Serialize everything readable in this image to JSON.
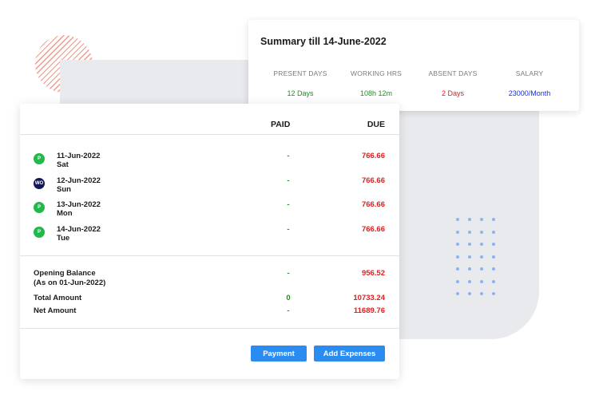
{
  "summary": {
    "title": "Summary till 14-June-2022",
    "stats": [
      {
        "label": "PRESENT DAYS",
        "value": "12 Days",
        "color": "#1f8d1f"
      },
      {
        "label": "WORKING HRS",
        "value": "108h 12m",
        "color": "#1f8d1f"
      },
      {
        "label": "ABSENT DAYS",
        "value": "2 Days",
        "color": "#e01d1d"
      },
      {
        "label": "SALARY",
        "value": "23000/Month",
        "color": "#1a2ee0"
      }
    ]
  },
  "table": {
    "col_paid": "PAID",
    "col_due": "DUE",
    "rows": [
      {
        "badge": "P",
        "date": "11-Jun-2022",
        "day": "Sat",
        "paid": "-",
        "due": "766.66"
      },
      {
        "badge": "WO",
        "date": "12-Jun-2022",
        "day": "Sun",
        "paid": "-",
        "due": "766.66"
      },
      {
        "badge": "P",
        "date": "13-Jun-2022",
        "day": "Mon",
        "paid": "-",
        "due": "766.66"
      },
      {
        "badge": "P",
        "date": "14-Jun-2022",
        "day": "Tue",
        "paid": "-",
        "due": "766.66"
      }
    ]
  },
  "totals": {
    "opening_label": "Opening Balance",
    "opening_sub": "(As on 01-Jun-2022)",
    "opening_paid": "-",
    "opening_due": "956.52",
    "total_label": "Total Amount",
    "total_paid": "0",
    "total_due": "10733.24",
    "net_label": "Net Amount",
    "net_paid": "-",
    "net_due": "11689.76"
  },
  "actions": {
    "payment": "Payment",
    "add_expenses": "Add Expenses"
  },
  "colors": {
    "accent": "#2a8cf0",
    "present": "#22b84c",
    "week_off": "#12195a",
    "due": "#e01d1d",
    "paid": "#1f8d1f"
  }
}
